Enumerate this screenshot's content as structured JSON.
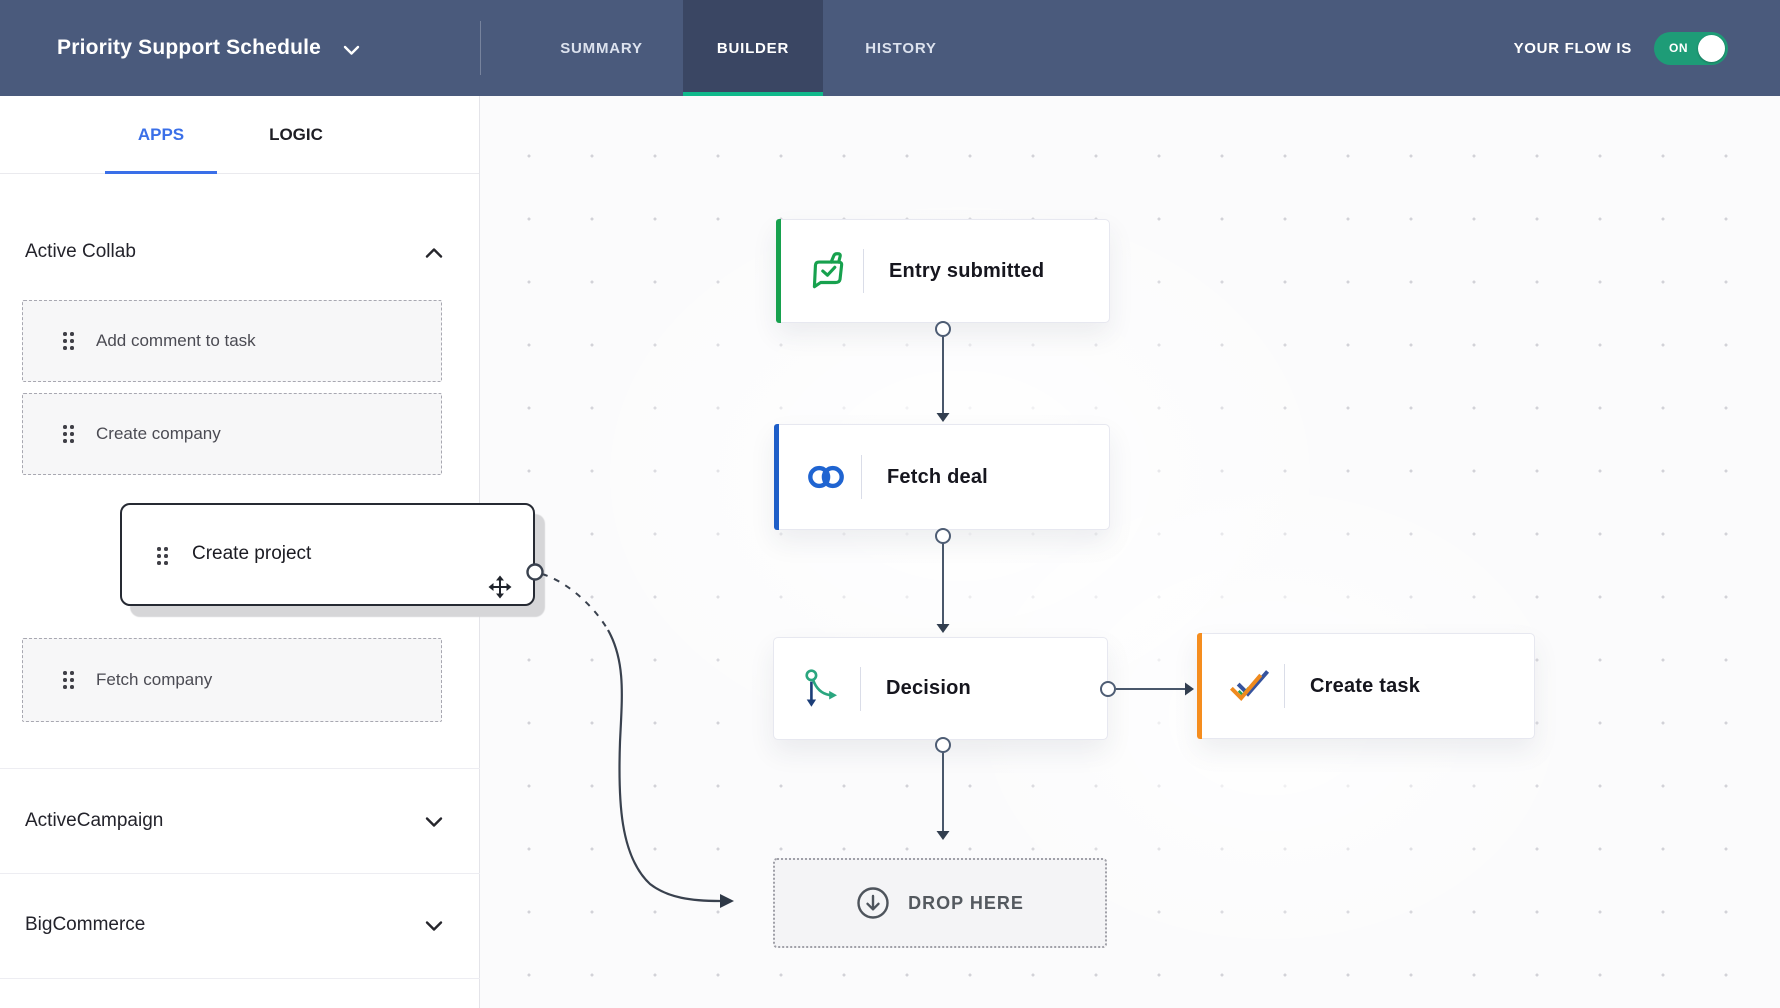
{
  "navbar": {
    "title": "Priority Support Schedule",
    "tabs": [
      {
        "label": "SUMMARY",
        "active": false
      },
      {
        "label": "BUILDER",
        "active": true
      },
      {
        "label": "HISTORY",
        "active": false
      }
    ],
    "status_label": "YOUR FLOW IS",
    "toggle": {
      "state_label": "ON",
      "on": true,
      "color": "#1E9C77"
    },
    "colors": {
      "background": "#4A5A7C",
      "active_tab_background": "#3A4663",
      "active_tab_underline": "#10B98B"
    }
  },
  "sidebar": {
    "tabs": [
      {
        "label": "APPS",
        "active": true
      },
      {
        "label": "LOGIC",
        "active": false
      }
    ],
    "active_tab_color": "#3A6FE8",
    "sections": [
      {
        "label": "Active Collab",
        "expanded": true,
        "items": [
          {
            "label": "Add comment to task"
          },
          {
            "label": "Create company"
          },
          {
            "label": "Fetch company"
          }
        ]
      },
      {
        "label": "ActiveCampaign",
        "expanded": false
      },
      {
        "label": "BigCommerce",
        "expanded": false
      }
    ],
    "dragging_item": {
      "label": "Create project"
    }
  },
  "canvas": {
    "nodes": [
      {
        "label": "Entry submitted",
        "icon": "forms-icon",
        "accent_color": "#17A14E"
      },
      {
        "label": "Fetch deal",
        "icon": "crm-link-icon",
        "accent_color": "#1E5EC8"
      },
      {
        "label": "Decision",
        "icon": "decision-branch-icon",
        "accent_color": null
      },
      {
        "label": "Create task",
        "icon": "double-check-icon",
        "accent_color": "#F58D1E"
      }
    ],
    "drop_target": {
      "label": "DROP HERE",
      "icon": "arrow-down-circle-icon"
    }
  }
}
